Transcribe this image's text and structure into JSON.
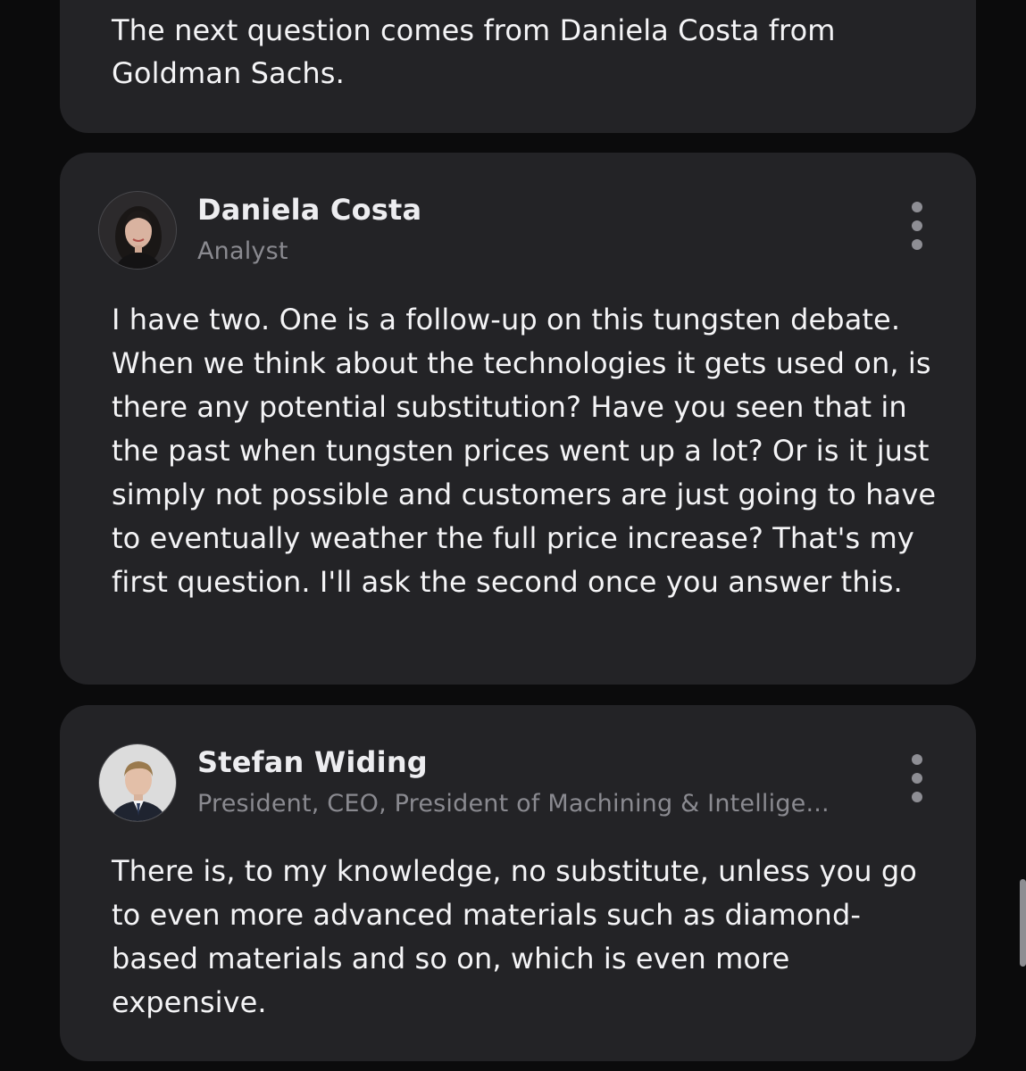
{
  "operator": {
    "text": "The next question comes from Daniela Costa from Goldman Sachs."
  },
  "entries": [
    {
      "name": "Daniela Costa",
      "role": "Analyst",
      "text": "I have two. One is a follow-up on this tungsten debate. When we think about the technologies it gets used on, is there any potential substitution? Have you seen that in the past when tungsten prices went up a lot? Or is it just simply not possible and customers are just going to have to eventually weather the full price increase? That's my first question. I'll ask the second once you answer this."
    },
    {
      "name": "Stefan Widing",
      "role": "President, CEO, President of Machining & Intellige...",
      "text": "There is, to my knowledge, no substitute, unless you go to even more advanced materials such as diamond-based materials and so on, which is even more expensive."
    }
  ],
  "icons": {
    "more": "more-vertical-icon"
  },
  "colors": {
    "background": "#0b0b0c",
    "card": "#232326",
    "text": "#f4f4f6",
    "muted": "#8a8a90"
  }
}
